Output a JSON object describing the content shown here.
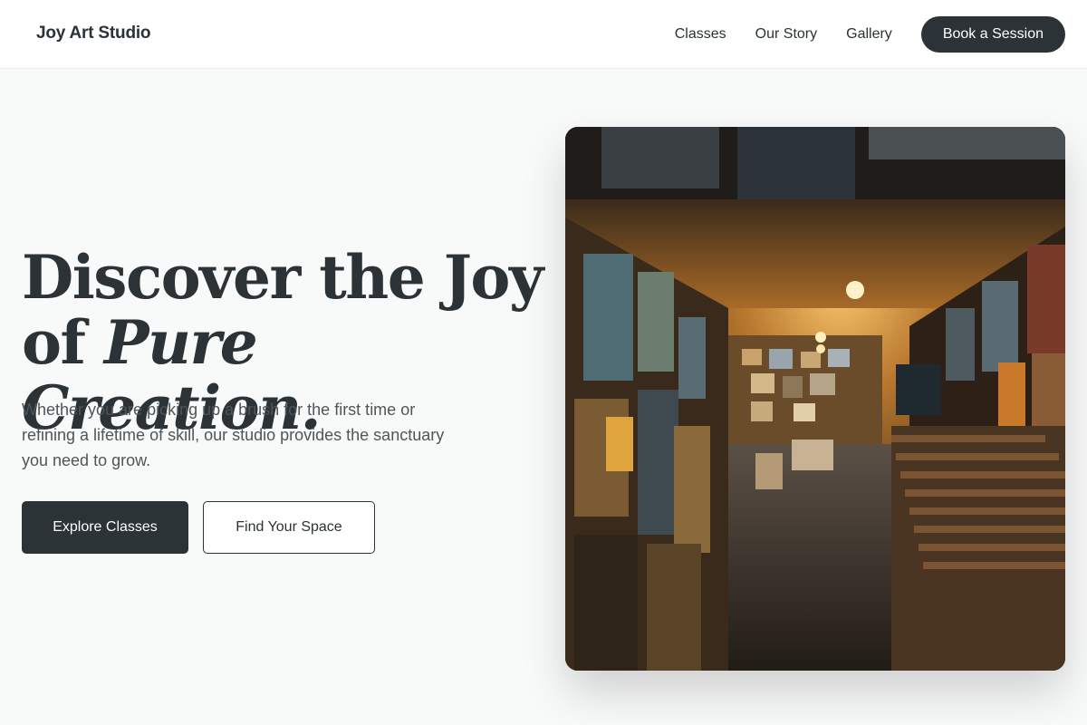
{
  "header": {
    "brand": "Joy Art Studio",
    "nav": [
      {
        "label": "Classes"
      },
      {
        "label": "Our Story"
      },
      {
        "label": "Gallery"
      }
    ],
    "cta_label": "Book a Session"
  },
  "hero": {
    "title_line1": "Discover the Joy",
    "title_line2_prefix": "of ",
    "title_line2_emphasis": "Pure Creation.",
    "subtitle": "Whether you are picking up a brush for the first time or refining a lifetime of skill, our studio provides the sanctuary you need to grow.",
    "primary_button": "Explore Classes",
    "secondary_button": "Find Your Space"
  },
  "colors": {
    "primary": "#2b3336",
    "background": "#f8f9f9",
    "surface": "#ffffff"
  }
}
